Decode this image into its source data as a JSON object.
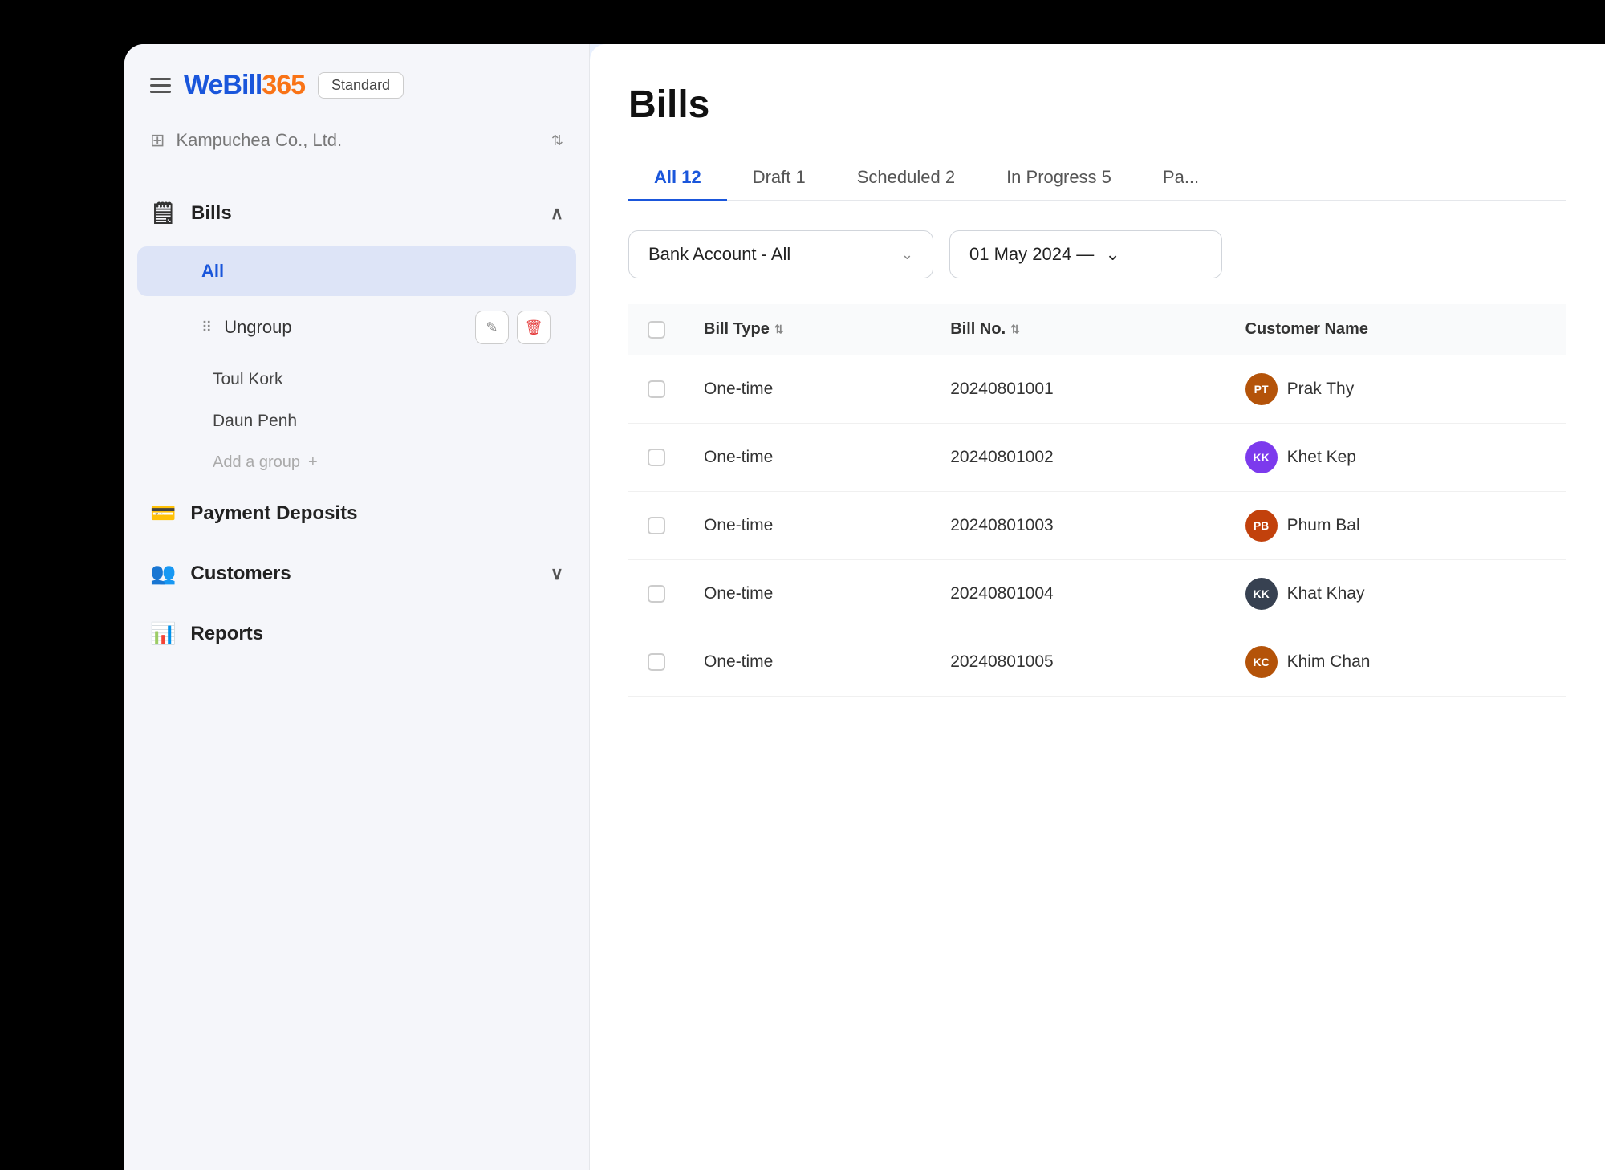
{
  "app": {
    "logo": {
      "prefix": "WeBill",
      "suffix": "365"
    },
    "plan_badge": "Standard"
  },
  "company": {
    "name": "Kampuchea Co., Ltd."
  },
  "sidebar": {
    "bills_label": "Bills",
    "all_label": "All",
    "ungroup_label": "Ungroup",
    "toul_kork_label": "Toul Kork",
    "daun_penh_label": "Daun Penh",
    "add_group_label": "Add a group",
    "payment_deposits_label": "Payment Deposits",
    "customers_label": "Customers",
    "reports_label": "Reports"
  },
  "main": {
    "page_title": "Bills",
    "tabs": [
      {
        "id": "all",
        "label": "All",
        "count": 12,
        "active": true
      },
      {
        "id": "draft",
        "label": "Draft",
        "count": 1,
        "active": false
      },
      {
        "id": "scheduled",
        "label": "Scheduled",
        "count": 2,
        "active": false
      },
      {
        "id": "in-progress",
        "label": "In Progress",
        "count": 5,
        "active": false
      },
      {
        "id": "paid",
        "label": "Pa...",
        "count": null,
        "active": false
      }
    ],
    "filters": {
      "bank_account_label": "Bank Account - All",
      "date_label": "01 May 2024 —"
    },
    "table": {
      "headers": [
        {
          "id": "bill-type",
          "label": "Bill Type",
          "sortable": true
        },
        {
          "id": "bill-no",
          "label": "Bill No.",
          "sortable": true
        },
        {
          "id": "customer-name",
          "label": "Customer Name",
          "sortable": false
        }
      ],
      "rows": [
        {
          "id": 1,
          "bill_type": "One-time",
          "bill_no": "20240801001",
          "customer_name": "Prak Thy",
          "avatar_color": "#b45309",
          "avatar_initials": "PT"
        },
        {
          "id": 2,
          "bill_type": "One-time",
          "bill_no": "20240801002",
          "customer_name": "Khet Kep",
          "avatar_color": "#7c3aed",
          "avatar_initials": "KK"
        },
        {
          "id": 3,
          "bill_type": "One-time",
          "bill_no": "20240801003",
          "customer_name": "Phum Bal",
          "avatar_color": "#c2410c",
          "avatar_initials": "PB"
        },
        {
          "id": 4,
          "bill_type": "One-time",
          "bill_no": "20240801004",
          "customer_name": "Khat Khay",
          "avatar_color": "#374151",
          "avatar_initials": "KK"
        },
        {
          "id": 5,
          "bill_type": "One-time",
          "bill_no": "20240801005",
          "customer_name": "Khim Chan",
          "avatar_color": "#b45309",
          "avatar_initials": "KC"
        }
      ]
    }
  },
  "icons": {
    "hamburger": "☰",
    "company": "⊞",
    "chevron_up": "∧",
    "chevron_down": "∨",
    "dots": "⠿",
    "edit": "✎",
    "delete": "🗑",
    "plus": "+",
    "dropdown_chevron": "⌄",
    "sort": "⇅"
  }
}
